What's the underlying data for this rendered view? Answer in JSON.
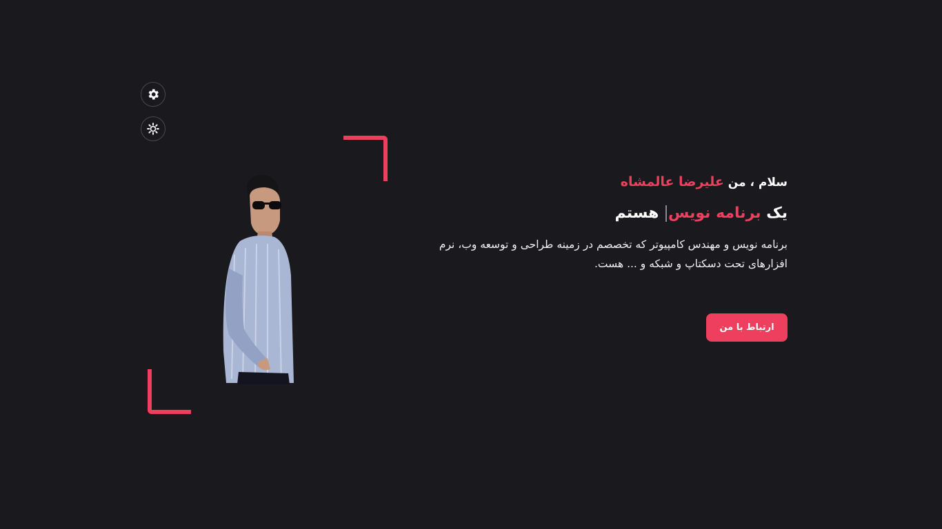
{
  "colors": {
    "background": "#1a191d",
    "accent": "#ef3f5f",
    "text": "#ffffff"
  },
  "side_buttons": [
    {
      "icon": "gear-icon"
    },
    {
      "icon": "sun-icon"
    }
  ],
  "intro": {
    "greeting_prefix": "سلام ، من",
    "name": "علیرضا عالمشاه",
    "role_prefix": "یک",
    "role_accent": "برنامه نویس",
    "role_suffix": "هستم",
    "description": "برنامه نویس و مهندس کامپیوتر که تخصصم در زمینه طراحی و توسعه وب، نرم افزارهای تحت دسکتاپ و شبکه و ... هست."
  },
  "contact_button": {
    "label": "ارتباط با من"
  }
}
